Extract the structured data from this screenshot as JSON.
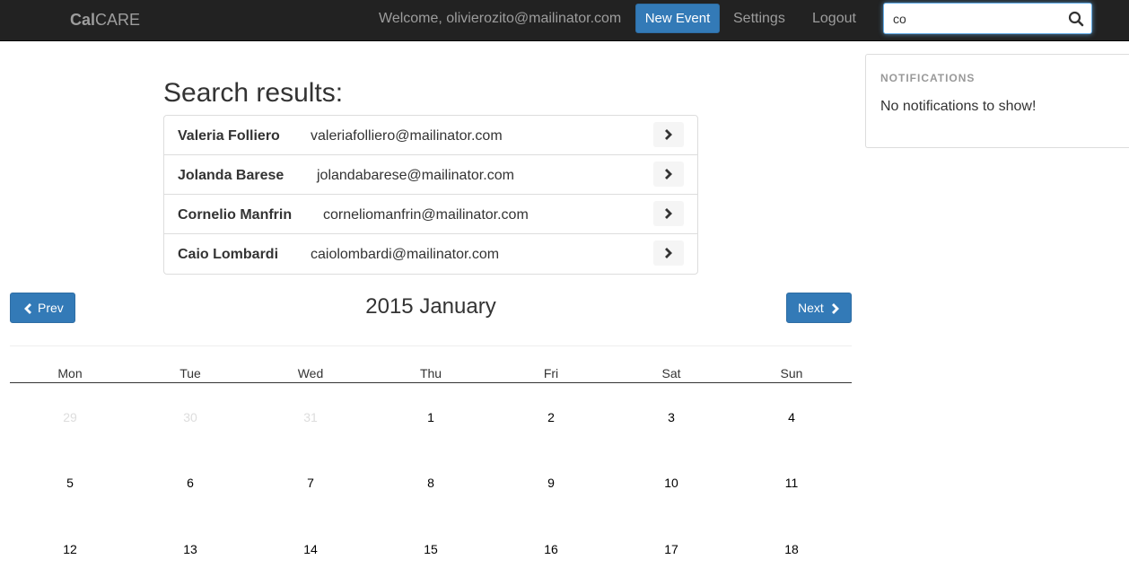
{
  "navbar": {
    "brand_bold": "Cal",
    "brand_rest": "CARE",
    "welcome": "Welcome, olivierozito@mailinator.com",
    "new_event_label": "New Event",
    "settings_label": "Settings",
    "logout_label": "Logout",
    "search_value": "co",
    "accent_color": "#337ab7"
  },
  "notifications": {
    "title": "NOTIFICATIONS",
    "empty_text": "No notifications to show!"
  },
  "search_results": {
    "title": "Search results:",
    "items": [
      {
        "name": "Valeria Folliero",
        "email": "valeriafolliero@mailinator.com"
      },
      {
        "name": "Jolanda Barese",
        "email": "jolandabarese@mailinator.com"
      },
      {
        "name": "Cornelio Manfrin",
        "email": "corneliomanfrin@mailinator.com"
      },
      {
        "name": "Caio Lombardi",
        "email": "caiolombardi@mailinator.com"
      }
    ]
  },
  "calendar": {
    "prev_label": "Prev",
    "next_label": "Next",
    "month_title": "2015 January",
    "weekdays": [
      "Mon",
      "Tue",
      "Wed",
      "Thu",
      "Fri",
      "Sat",
      "Sun"
    ],
    "weeks": [
      [
        "29",
        "30",
        "31",
        "1",
        "2",
        "3",
        "4"
      ],
      [
        "5",
        "6",
        "7",
        "8",
        "9",
        "10",
        "11"
      ],
      [
        "12",
        "13",
        "14",
        "15",
        "16",
        "17",
        "18"
      ]
    ],
    "muted_days": [
      "29",
      "30",
      "31"
    ]
  }
}
